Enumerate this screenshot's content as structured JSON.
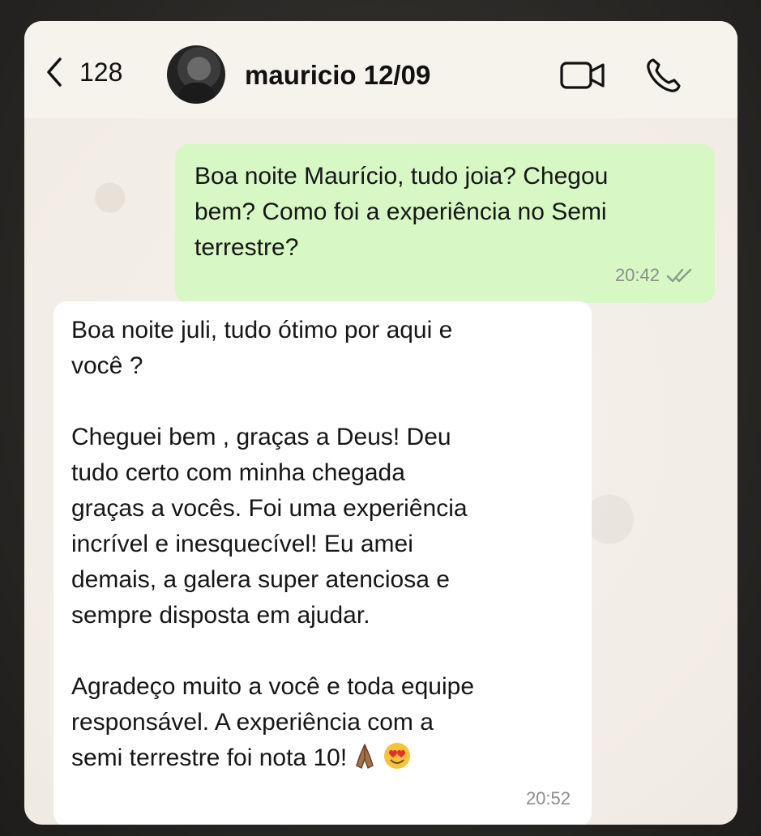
{
  "header": {
    "back_count": "128",
    "contact_name": "mauricio 12/09",
    "icons": [
      "chevron-left-icon",
      "video-call-icon",
      "phone-icon"
    ]
  },
  "messages": [
    {
      "direction": "outgoing",
      "text": "Boa noite Maurício, tudo joia? Chegou\nbem? Como foi a experiência no Semi\nterrestre?",
      "time": "20:42",
      "status": "read"
    },
    {
      "direction": "incoming",
      "text": "Boa noite juli, tudo ótimo por aqui e\nvocê ?\n\nCheguei bem , graças a Deus! Deu\ntudo certo com minha chegada\ngraças a vocês. Foi uma experiência\nincrível e inesquecível! Eu amei\ndemais, a galera super atenciosa e\nsempre disposta em ajudar.\n\nAgradeço muito a você e toda equipe\nresponsável. A experiência com a\nsemi terrestre foi nota 10!",
      "emojis": [
        "folded-hands",
        "heart-eyes"
      ],
      "time": "20:52"
    }
  ],
  "colors": {
    "outgoing_bubble": "#d7f8c4",
    "incoming_bubble": "#ffffff",
    "chat_background": "#f1ece4"
  }
}
